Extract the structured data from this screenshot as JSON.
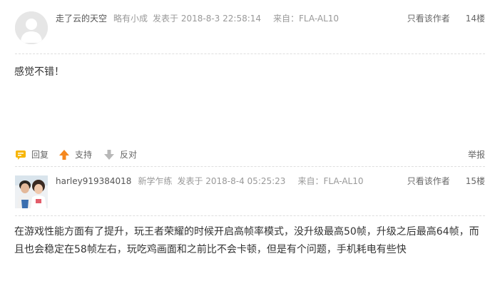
{
  "posts": [
    {
      "user": "走了云的天空",
      "rank": "略有小成",
      "date": "发表于 2018-8-3 22:58:14",
      "source": "来自：FLA-AL10",
      "only_author": "只看该作者",
      "floor": "14楼",
      "content": "感觉不错！",
      "actions": {
        "reply": "回复",
        "support": "支持",
        "oppose": "反对",
        "report": "举报"
      }
    },
    {
      "user": "harley919384018",
      "rank": "新学乍练",
      "date": "发表于 2018-8-4 05:25:23",
      "source": "来自：FLA-AL10",
      "only_author": "只看该作者",
      "floor": "15楼",
      "content": "在游戏性能方面有了提升，玩王者荣耀的时候开启高帧率模式，没升级最高50帧，升级之后最高64帧，而且也会稳定在58帧左右，玩吃鸡画面和之前比不会卡顿，但是有个问题，手机耗电有些快"
    }
  ],
  "colors": {
    "meta_text": "#999999",
    "support_arrow": "#f5881f",
    "oppose_arrow": "#b8b8b8",
    "reply_bubble": "#f7b500"
  },
  "icons": {
    "reply": "speech-bubble-icon",
    "support": "arrow-up-icon",
    "oppose": "arrow-down-icon",
    "avatar_default": "default-avatar-icon"
  }
}
